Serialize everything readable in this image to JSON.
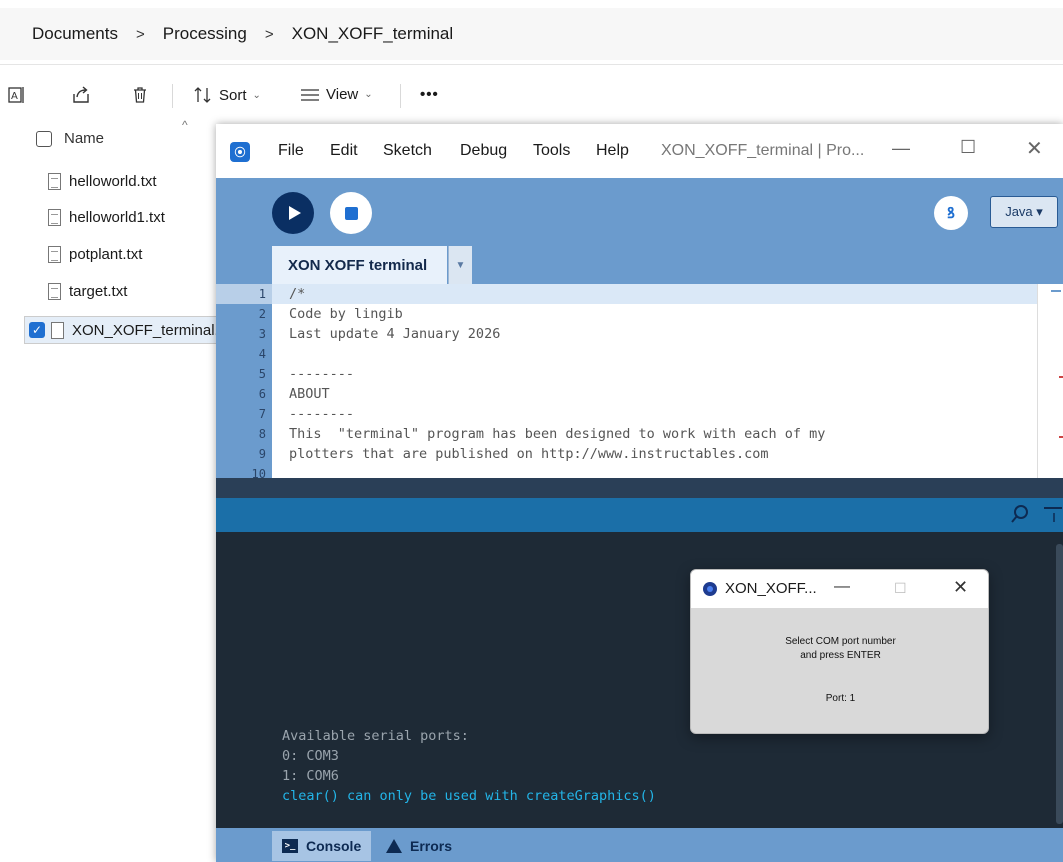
{
  "explorer": {
    "breadcrumb": [
      "Documents",
      "Processing",
      "XON_XOFF_terminal"
    ],
    "breadcrumb_separator": ">",
    "toolbar": {
      "sort_label": "Sort",
      "view_label": "View",
      "more_label": "•••"
    },
    "column_header": "Name",
    "files": [
      {
        "name": "helloworld.txt"
      },
      {
        "name": "helloworld1.txt"
      },
      {
        "name": "potplant.txt"
      },
      {
        "name": "target.txt"
      },
      {
        "name": "XON_XOFF_terminal.p",
        "selected": true
      }
    ]
  },
  "processing": {
    "menu": [
      "File",
      "Edit",
      "Sketch",
      "Debug",
      "Tools",
      "Help"
    ],
    "window_title": "XON_XOFF_terminal | Pro...",
    "mode": "Java ▾",
    "tab_label": "XON XOFF terminal",
    "code_lines": [
      "/*",
      "Code by lingib",
      "Last update 4 January 2026",
      "",
      "--------",
      "ABOUT",
      "--------",
      "This  \"terminal\" program has been designed to work with each of my",
      "plotters that are published on http://www.instructables.com",
      ""
    ],
    "line_numbers": [
      "1",
      "2",
      "3",
      "4",
      "5",
      "6",
      "7",
      "8",
      "9",
      "10"
    ],
    "console_lines": [
      {
        "text": "Available serial ports:",
        "color": "#9aa4ad"
      },
      {
        "text": "0: COM3",
        "color": "#9aa4ad"
      },
      {
        "text": "1: COM6",
        "color": "#9aa4ad"
      },
      {
        "text": "clear() can only be used with createGraphics()",
        "color": "#23b5e8"
      }
    ],
    "footer_tabs": {
      "console": "Console",
      "errors": "Errors"
    }
  },
  "sketch_window": {
    "title": "XON_XOFF...",
    "prompt_line1": "Select COM port number",
    "prompt_line2": "and press ENTER",
    "port_label": "Port: 1"
  },
  "colors": {
    "processing_blue": "#6b9bcd",
    "run_button": "#0a2f63",
    "status_bar": "#1b6fa8",
    "console_bg": "#1e2a36",
    "console_error": "#23b5e8"
  }
}
